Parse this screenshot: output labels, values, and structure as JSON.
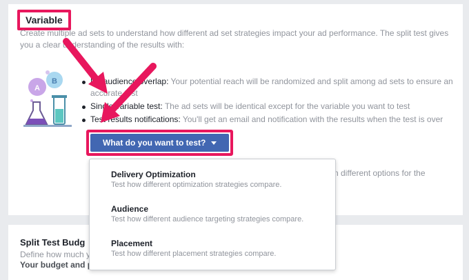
{
  "variable_section": {
    "label": "Variable",
    "intro": "Create multiple ad sets to understand how different ad set strategies impact your ad performance. The split test gives you a clear understanding of the results with:",
    "bullets": [
      {
        "strong": "No audience overlap: ",
        "text": "Your potential reach will be randomized and split among ad sets to ensure an accurate test"
      },
      {
        "strong": "Single variable test: ",
        "text": "The ad sets will be identical except for the variable you want to test"
      },
      {
        "strong": "Test results notifications: ",
        "text": "You'll get an email and notification with the results when the test is over"
      }
    ],
    "test_button_label": "What do you want to test?",
    "trailing_text": "n different options for the",
    "accent_color": "#e8175d",
    "button_color": "#4267b2"
  },
  "dropdown": {
    "items": [
      {
        "title": "Delivery Optimization",
        "desc": "Test how different optimization strategies compare."
      },
      {
        "title": "Audience",
        "desc": "Test how different audience targeting strategies compare."
      },
      {
        "title": "Placement",
        "desc": "Test how different placement strategies compare."
      }
    ]
  },
  "budget_section": {
    "title": "Split Test Budg",
    "desc": "Define how much y",
    "strong": "Your budget and p"
  },
  "illustration": {
    "icon": "science-flask-icon",
    "bubble_a": "A",
    "bubble_b": "B"
  }
}
